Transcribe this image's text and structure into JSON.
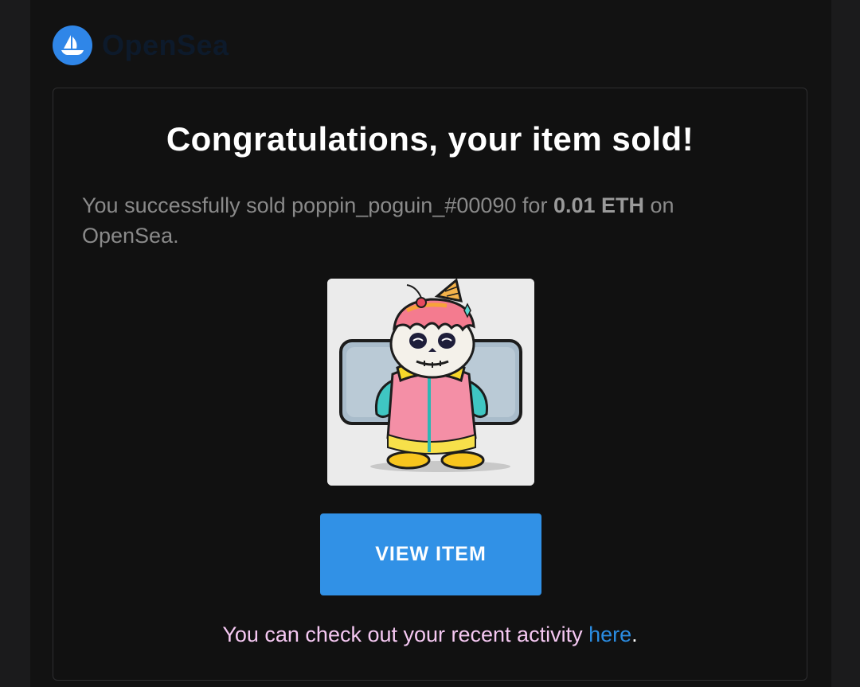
{
  "brand": {
    "name": "OpenSea",
    "logo_icon": "sailboat-icon",
    "logo_color": "#2f86e8"
  },
  "email": {
    "title": "Congratulations, your item sold!",
    "message_prefix": "You successfully sold poppin_poguin_#00090 for ",
    "price": "0.01 ETH",
    "message_suffix": " on OpenSea.",
    "item_image": "nft-thumbnail",
    "button_label": "VIEW ITEM",
    "footer_text": "You can check out your recent activity ",
    "footer_link": "here",
    "footer_end": "."
  },
  "colors": {
    "accent": "#3191e6",
    "background": "#121212",
    "link": "#2a8be0",
    "footer_text": "#f5c8f2"
  }
}
